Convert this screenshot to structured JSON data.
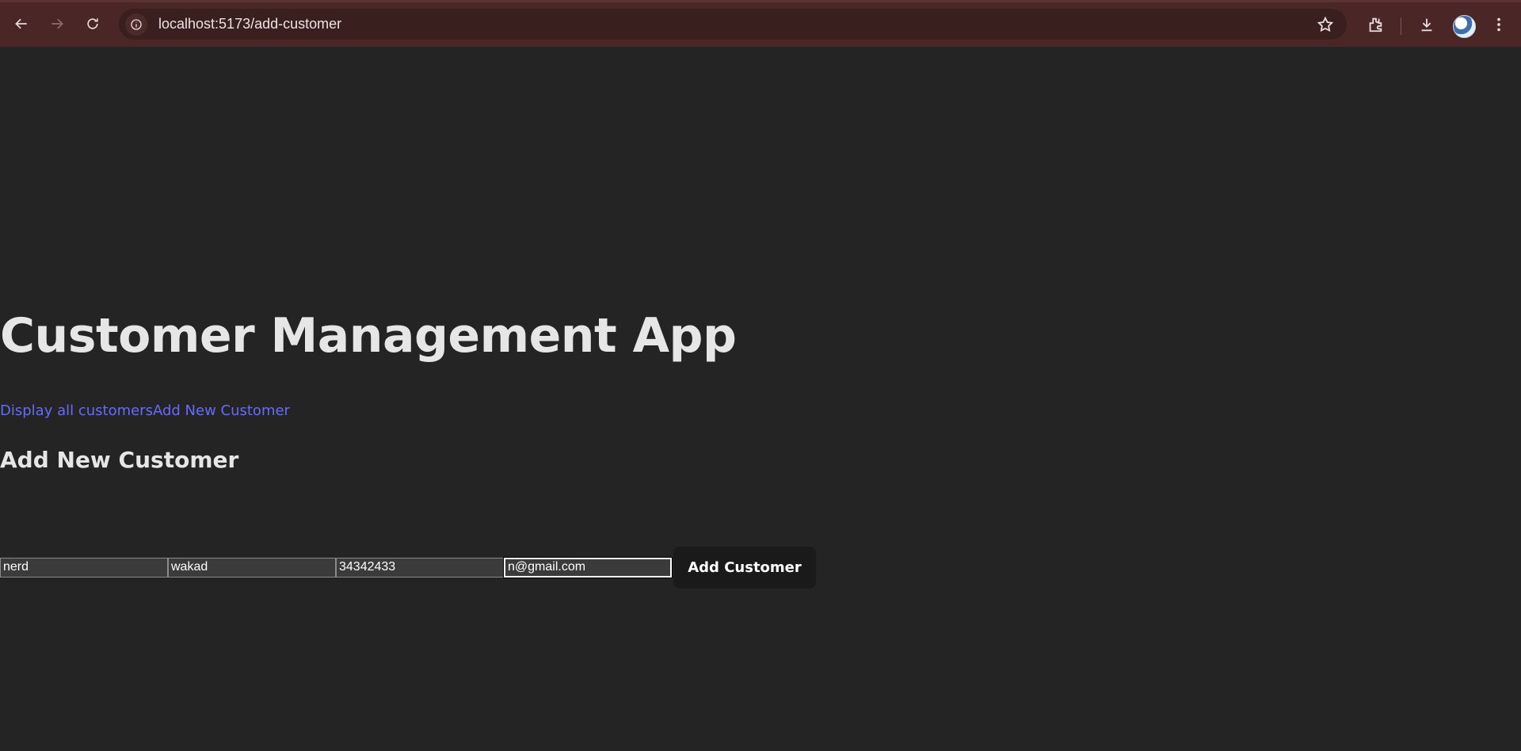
{
  "browser": {
    "url": "localhost:5173/add-customer",
    "icons": [
      "back-icon",
      "forward-icon",
      "reload-icon",
      "site-info-icon",
      "bookmark-star-icon",
      "extensions-icon",
      "download-icon",
      "profile-avatar",
      "menu-icon"
    ]
  },
  "app": {
    "title": "Customer Management App",
    "nav": {
      "display_all": "Display all customers",
      "add_new": "Add New Customer"
    },
    "section_title": "Add New Customer",
    "form": {
      "name_value": "nerd",
      "address_value": "wakad",
      "phone_value": "34342433",
      "email_value": "n@gmail.com",
      "submit_label": "Add Customer"
    }
  },
  "colors": {
    "chrome_bg": "#4a2626",
    "page_bg": "#242424",
    "link": "#646cff",
    "button_bg": "#1a1a1a"
  }
}
